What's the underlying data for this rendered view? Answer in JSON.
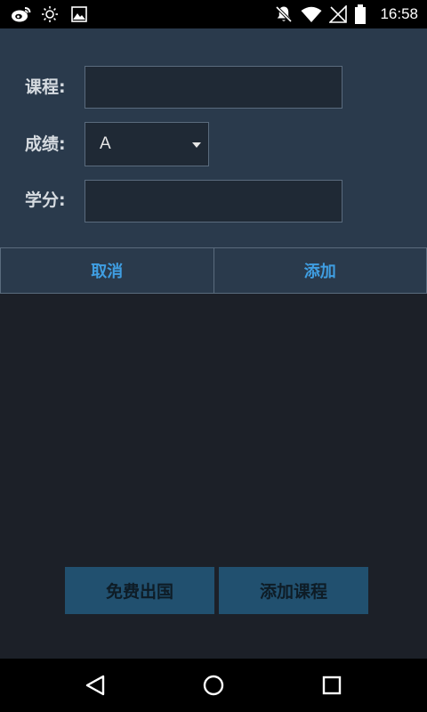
{
  "status_bar": {
    "time": "16:58",
    "left_icons": [
      "weibo-icon",
      "brightness-icon",
      "image-icon"
    ],
    "right_icons": [
      "notifications-off-icon",
      "wifi-icon",
      "no-signal-icon",
      "battery-icon"
    ]
  },
  "dialog": {
    "fields": {
      "course_label": "课程:",
      "course_value": "",
      "grade_label": "成绩:",
      "grade_value": "A",
      "credit_label": "学分:",
      "credit_value": ""
    },
    "buttons": {
      "cancel_label": "取消",
      "add_label": "添加"
    }
  },
  "main": {
    "free_abroad_label": "免费出国",
    "add_course_label": "添加课程"
  },
  "nav_bar": {
    "icons": [
      "back-icon",
      "home-icon",
      "recents-icon"
    ]
  },
  "colors": {
    "dialog_bg": "#2a3a4c",
    "page_bg": "#1c2028",
    "accent": "#3f9ee2",
    "action_button_bg": "#21506f"
  }
}
